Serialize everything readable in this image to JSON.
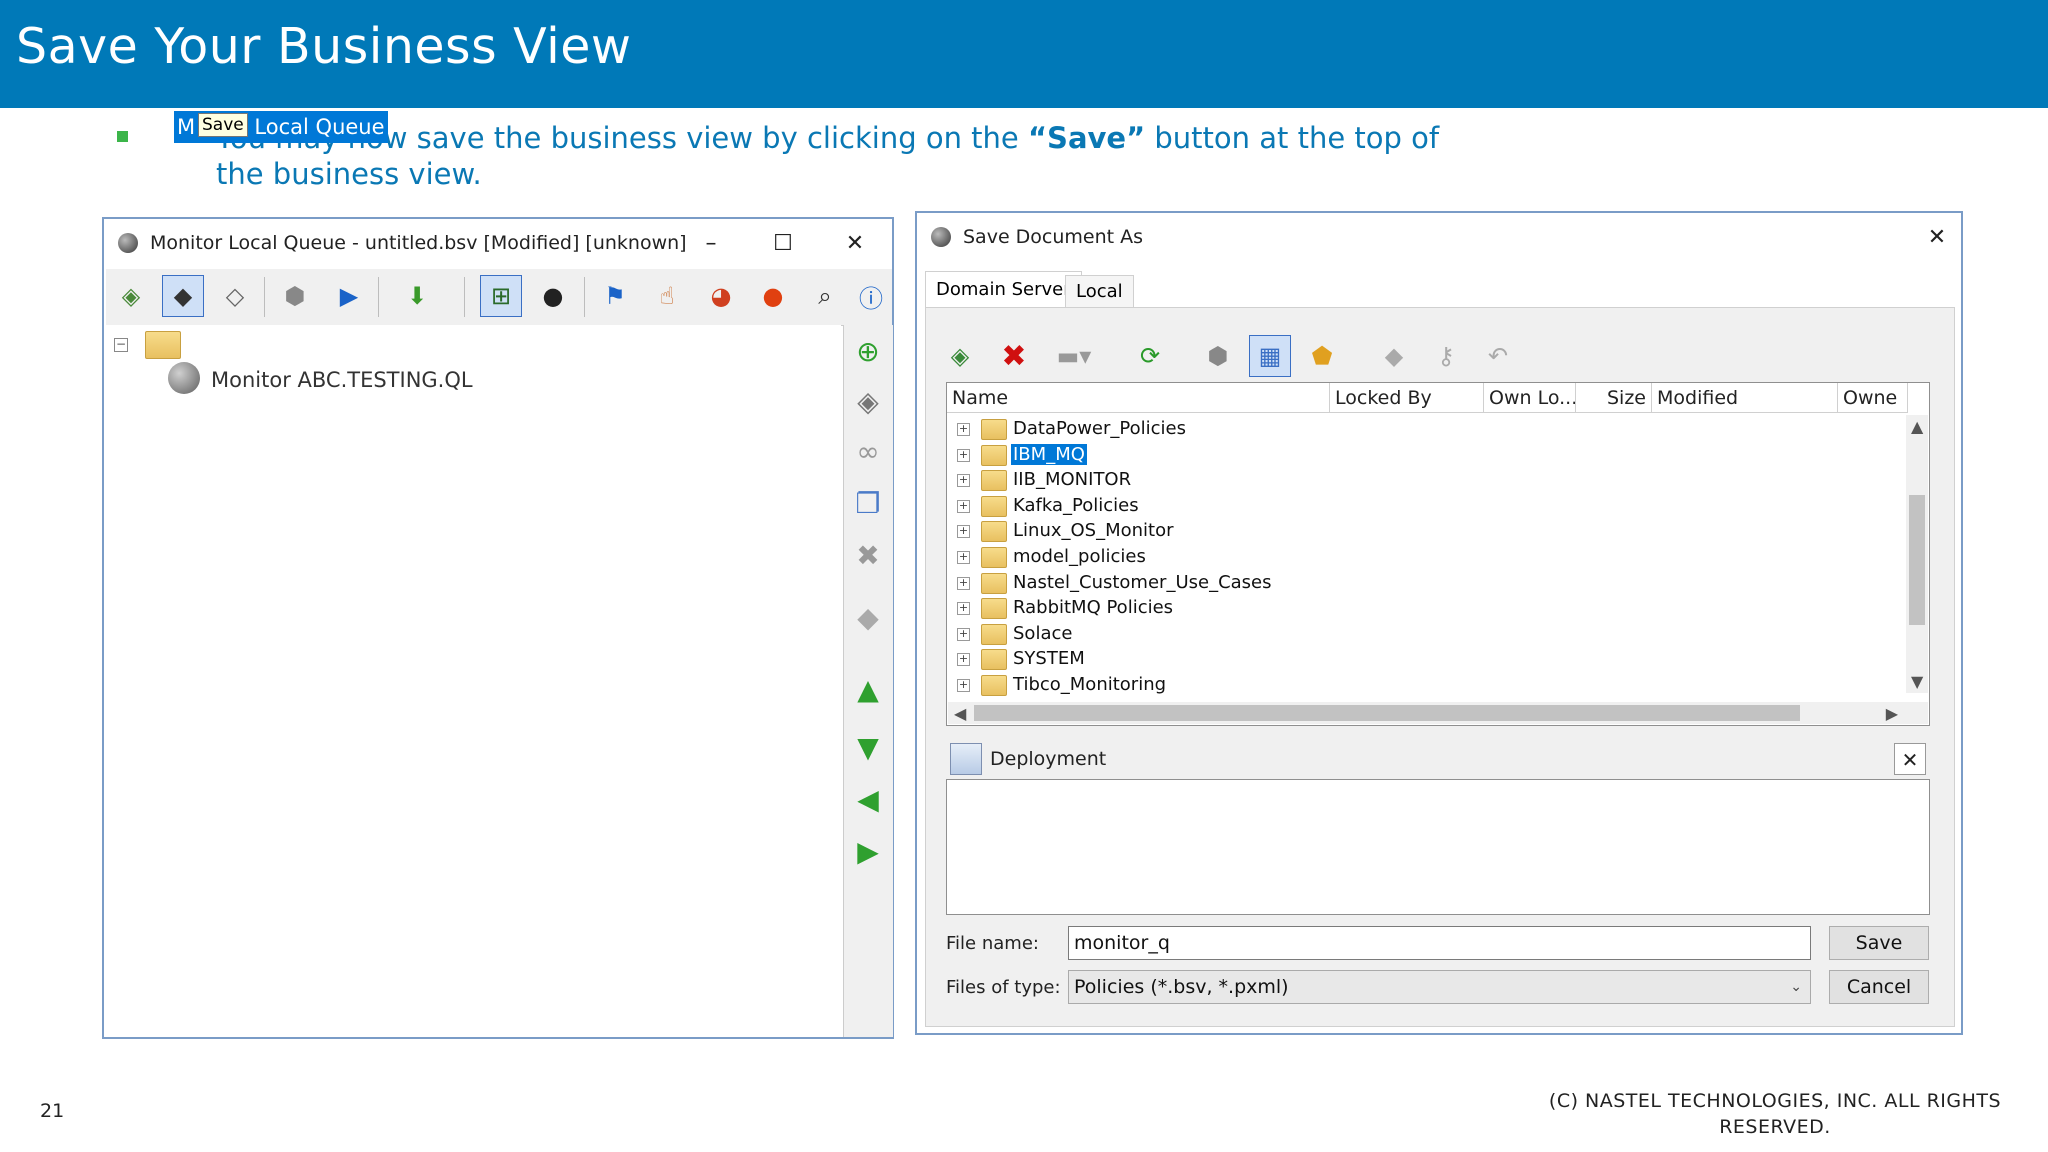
{
  "slide": {
    "title": "Save Your Business View",
    "bullet_text_before": "You may now save the business view by clicking on the ",
    "bullet_text_bold": "“Save”",
    "bullet_text_after": " button at the top of the business view.",
    "page_number": "21",
    "copyright": "(C) NASTEL TECHNOLOGIES, INC. ALL RIGHTS RESERVED."
  },
  "left_window": {
    "title": "Monitor Local Queue - untitled.bsv [Modified] [unknown]",
    "tooltip": "Save",
    "root_node_label_prefix": "M",
    "root_node_label": "r Local Queue",
    "child_node_label": "Monitor ABC.TESTING.QL",
    "toolbar_icons": [
      "open-icon",
      "save-icon",
      "save-as-icon",
      "cube-icon",
      "play-icon",
      "down-arrow-icon",
      "tree-view-icon",
      "globe-icon",
      "flag-icon",
      "hand-icon",
      "pie-chart-icon",
      "alert-icon",
      "search-icon",
      "info-icon"
    ],
    "side_icons": [
      "add-icon",
      "open-icon",
      "link-icon",
      "copy-icon",
      "delete-icon",
      "tag-icon",
      "up-arrow-icon",
      "down-arrow-icon",
      "left-arrow-icon",
      "right-arrow-icon"
    ]
  },
  "dialog": {
    "title": "Save Document As",
    "tabs": [
      "Domain Server",
      "Local"
    ],
    "columns": [
      "Name",
      "Locked By",
      "Own Lo...",
      "Size",
      "Modified",
      "Owne"
    ],
    "folders": [
      "DataPower_Policies",
      "IBM_MQ",
      "IIB_MONITOR",
      "Kafka_Policies",
      "Linux_OS_Monitor",
      "model_policies",
      "Nastel_Customer_Use_Cases",
      "RabbitMQ Policies",
      "Solace",
      "SYSTEM",
      "Tibco_Monitoring"
    ],
    "selected_folder": "IBM_MQ",
    "deployment_title": "Deployment",
    "file_name_label": "File name:",
    "file_name_value": "monitor_q",
    "file_type_label": "Files of type:",
    "file_type_value": "Policies (*.bsv, *.pxml)",
    "save_label": "Save",
    "cancel_label": "Cancel"
  },
  "colors": {
    "banner": "#0079b8",
    "accent_text": "#0a78b4",
    "bullet": "#3cb54a",
    "selection": "#0078d7"
  }
}
